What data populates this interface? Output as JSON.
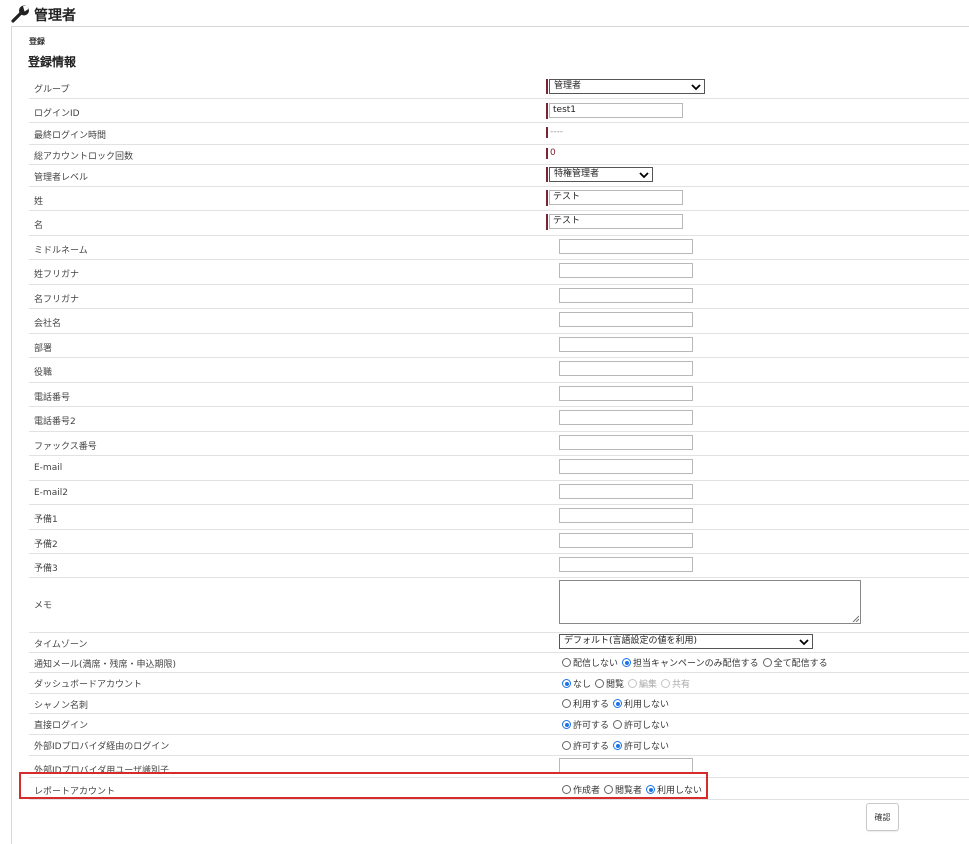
{
  "header": {
    "title": "管理者",
    "icon": "wrench-icon"
  },
  "breadcrumb": "登録",
  "section_title": "登録情報",
  "fields": {
    "group": {
      "label": "グループ",
      "value": "管理者"
    },
    "login_id": {
      "label": "ログインID",
      "value": "test1"
    },
    "last_login": {
      "label": "最終ログイン時間",
      "value": "----"
    },
    "lock_count": {
      "label": "総アカウントロック回数",
      "value": "0"
    },
    "admin_level": {
      "label": "管理者レベル",
      "value": "特権管理者"
    },
    "last_name": {
      "label": "姓",
      "value": "テスト"
    },
    "first_name": {
      "label": "名",
      "value": "テスト"
    },
    "middle_name": {
      "label": "ミドルネーム",
      "value": ""
    },
    "last_name_kana": {
      "label": "姓フリガナ",
      "value": ""
    },
    "first_name_kana": {
      "label": "名フリガナ",
      "value": ""
    },
    "company": {
      "label": "会社名",
      "value": ""
    },
    "department": {
      "label": "部署",
      "value": ""
    },
    "position": {
      "label": "役職",
      "value": ""
    },
    "phone": {
      "label": "電話番号",
      "value": ""
    },
    "phone2": {
      "label": "電話番号2",
      "value": ""
    },
    "fax": {
      "label": "ファックス番号",
      "value": ""
    },
    "email": {
      "label": "E-mail",
      "value": ""
    },
    "email2": {
      "label": "E-mail2",
      "value": ""
    },
    "spare1": {
      "label": "予備1",
      "value": ""
    },
    "spare2": {
      "label": "予備2",
      "value": ""
    },
    "spare3": {
      "label": "予備3",
      "value": ""
    },
    "memo": {
      "label": "メモ",
      "value": ""
    },
    "timezone": {
      "label": "タイムゾーン",
      "value": "デフォルト(言語設定の値を利用)"
    },
    "notify_mail": {
      "label": "通知メール(満席・残席・申込期限)",
      "options": [
        "配信しない",
        "担当キャンペーンのみ配信する",
        "全て配信する"
      ],
      "selected": 1
    },
    "dashboard": {
      "label": "ダッシュボードアカウント",
      "options": [
        "なし",
        "閲覧",
        "編集",
        "共有"
      ],
      "selected": 0
    },
    "sansan": {
      "label": "シャノン名刺",
      "options": [
        "利用する",
        "利用しない"
      ],
      "selected": 1
    },
    "direct_login": {
      "label": "直接ログイン",
      "options": [
        "許可する",
        "許可しない"
      ],
      "selected": 0
    },
    "idp_login": {
      "label": "外部IDプロバイダ経由のログイン",
      "options": [
        "許可する",
        "許可しない"
      ],
      "selected": 1
    },
    "idp_user_id": {
      "label": "外部IDプロバイダ用ユーザ識別子",
      "value": ""
    },
    "report_account": {
      "label": "レポートアカウント",
      "options": [
        "作成者",
        "閲覧者",
        "利用しない"
      ],
      "selected": 2
    }
  },
  "buttons": {
    "confirm": "確認"
  },
  "colors": {
    "required_bar": "#7b2330",
    "radio_selected": "#1a73e8",
    "highlight_border": "#d62c2c"
  }
}
